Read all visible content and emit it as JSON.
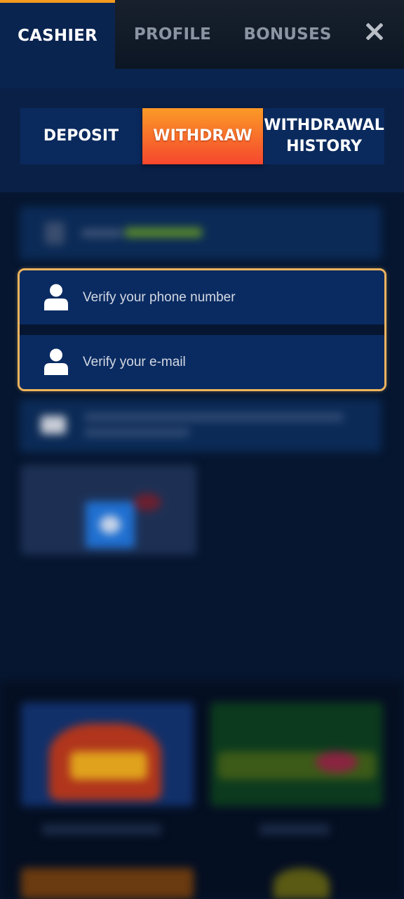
{
  "top_tabs": {
    "cashier": "CASHIER",
    "profile": "PROFILE",
    "bonuses": "BONUSES",
    "active": "cashier"
  },
  "close_icon": "close-icon",
  "segments": {
    "deposit": "DEPOSIT",
    "withdraw": "WITHDRAW",
    "history_line1": "WITHDRAWAL",
    "history_line2": "HISTORY",
    "active": "withdraw"
  },
  "verification": {
    "items": [
      {
        "label": "Verify your phone number",
        "icon": "person-icon"
      },
      {
        "label": "Verify your e-mail",
        "icon": "person-icon"
      }
    ]
  },
  "colors": {
    "active_tab_accent": "#f39a1f",
    "withdraw_gradient_top": "#fb9a27",
    "withdraw_gradient_bottom": "#f5472e",
    "verify_border": "#eeb45e",
    "panel_blue": "#0a2450"
  }
}
